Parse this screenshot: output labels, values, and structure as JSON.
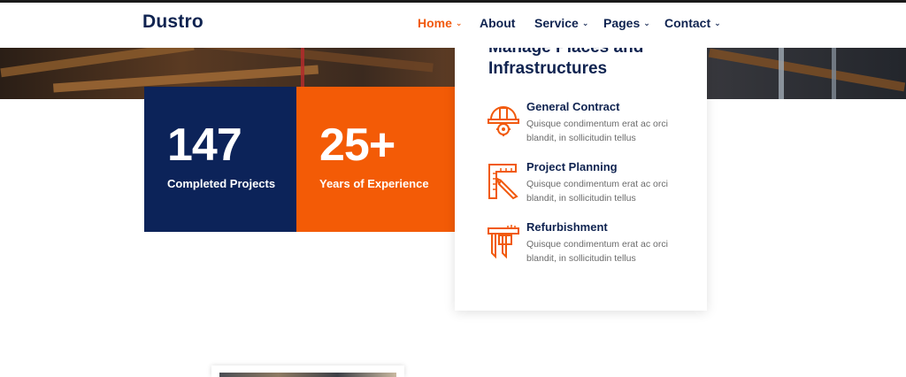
{
  "brand": {
    "logo_text": "Dustro"
  },
  "nav": {
    "items": [
      {
        "label": "Home",
        "chevron": "⌄",
        "active": true
      },
      {
        "label": "About",
        "chevron": "",
        "active": false
      },
      {
        "label": "Service",
        "chevron": "⌄",
        "active": false
      },
      {
        "label": "Pages",
        "chevron": "⌄",
        "active": false
      },
      {
        "label": "Contact",
        "chevron": "⌄",
        "active": false
      }
    ]
  },
  "stats": [
    {
      "value": "147",
      "label": "Completed Projects"
    },
    {
      "value": "25+",
      "label": "Years of Experience"
    }
  ],
  "services_card": {
    "title": "Manage Places and Infrastructures",
    "items": [
      {
        "name": "General Contract",
        "desc": "Quisque condimentum erat ac orci blandit, in sollicitudin tellus",
        "icon": "hard-hat-gear-icon"
      },
      {
        "name": "Project Planning",
        "desc": "Quisque condimentum erat ac orci blandit, in sollicitudin tellus",
        "icon": "ruler-pencil-icon"
      },
      {
        "name": "Refurbishment",
        "desc": "Quisque condimentum erat ac orci blandit, in sollicitudin tellus",
        "icon": "caliper-icon"
      }
    ]
  },
  "colors": {
    "navy": "#0c2359",
    "orange": "#f35b06",
    "heading": "#0f2350",
    "accent": "#f15a0e"
  }
}
